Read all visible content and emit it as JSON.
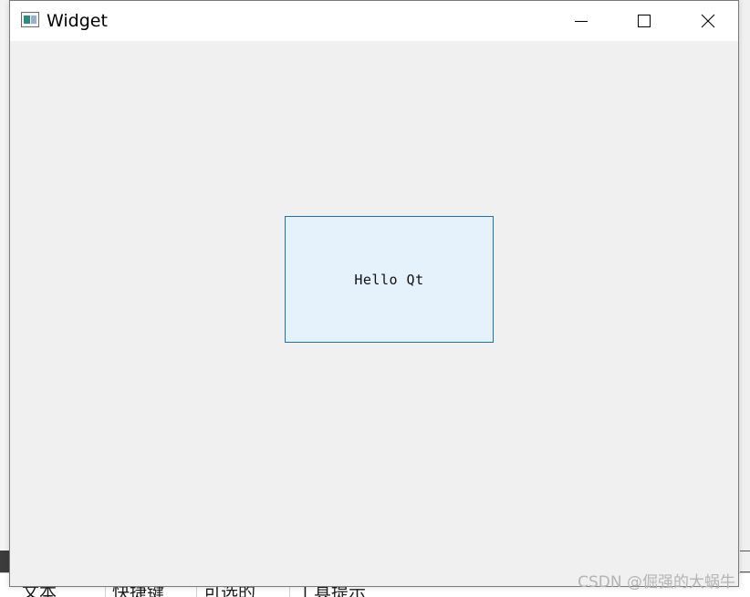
{
  "window": {
    "title": "Widget"
  },
  "label": {
    "text": "Hello Qt"
  },
  "background_table": {
    "columns": [
      "文本",
      "快捷键",
      "可选的",
      "工具提示"
    ]
  },
  "watermark": "CSDN @倔强的大蜗牛",
  "colors": {
    "label_border": "#1f6fb2",
    "label_background": "#e5f1fb",
    "window_background": "#f0f0f0",
    "titlebar_background": "#ffffff"
  },
  "icons": {
    "app": "app-window-icon",
    "minimize": "minimize-icon",
    "maximize": "maximize-icon",
    "close": "close-icon"
  }
}
